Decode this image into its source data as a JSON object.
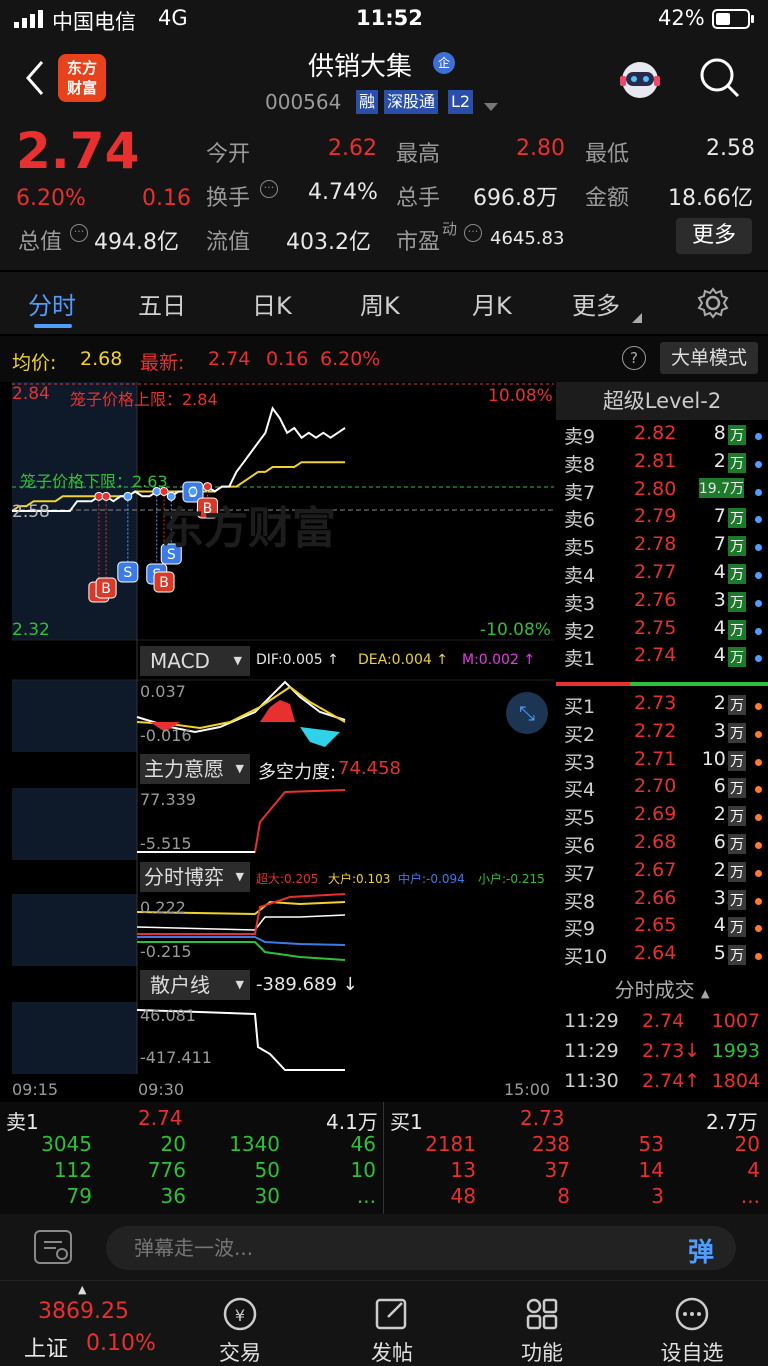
{
  "status": {
    "carrier": "中国电信",
    "network": "4G",
    "time": "11:52",
    "battery": "42%"
  },
  "header": {
    "logo_top": "东方",
    "logo_bottom": "财富",
    "stock_name": "供销大集",
    "badge": "企",
    "code": "000564",
    "tags": [
      "融",
      "深股通",
      "L2"
    ]
  },
  "quote": {
    "price": "2.74",
    "change_pct": "6.20%",
    "change": "0.16",
    "open_label": "今开",
    "open": "2.62",
    "high_label": "最高",
    "high": "2.80",
    "low_label": "最低",
    "low": "2.58",
    "turnover_label": "换手",
    "turnover": "4.74%",
    "volume_label": "总手",
    "volume": "696.8万",
    "amount_label": "金额",
    "amount": "18.66亿",
    "mcap_label": "总值",
    "mcap": "494.8亿",
    "float_label": "流值",
    "float": "403.2亿",
    "pe_label": "市盈",
    "pe_sup": "动",
    "pe": "4645.83",
    "more": "更多"
  },
  "tabs": [
    "分时",
    "五日",
    "日K",
    "周K",
    "月K",
    "更多"
  ],
  "avg": {
    "avg_label": "均价:",
    "avg": "2.68",
    "latest_label": "最新:",
    "latest": "2.74",
    "chg": "0.16",
    "pct": "6.20%",
    "help": "?",
    "mode": "大单模式"
  },
  "chart": {
    "price_top": "2.84",
    "price_mid": "2.58",
    "price_bottom": "2.32",
    "pct_top": "10.08%",
    "pct_bottom": "-10.08%",
    "upper_limit": "笼子价格上限：2.84",
    "lower_limit": "笼子价格下限：2.63",
    "watermark": "东方财富",
    "macd_label": "MACD",
    "dif": "DIF:0.005 ↑",
    "dea": "DEA:0.004 ↑",
    "m": "M:0.002 ↑",
    "macd_hi": "0.037",
    "macd_lo": "-0.016",
    "zl_label": "主力意愿",
    "zl_name": "多空力度:",
    "zl_val": "74.458",
    "zl_hi": "77.339",
    "zl_lo": "-5.515",
    "by_label": "分时博弈",
    "by_big": "超大:0.205",
    "by_large": "大户:0.103",
    "by_mid": "中户:-0.094",
    "by_small": "小户:-0.215",
    "by_hi": "0.222",
    "by_lo": "-0.215",
    "sh_label": "散户线",
    "sh_val": "-389.689 ↓",
    "sh_hi": "46.081",
    "sh_lo": "-417.411",
    "t0": "09:15",
    "t1": "09:30",
    "t2": "15:00",
    "price_series": [
      2.58,
      2.58,
      2.58,
      2.58,
      2.58,
      2.58,
      2.58,
      2.58,
      2.58,
      2.6,
      2.6,
      2.6,
      2.61,
      2.61,
      2.6,
      2.61,
      2.61,
      2.62,
      2.61,
      2.61,
      2.62,
      2.62,
      2.61,
      2.62,
      2.62,
      2.62,
      2.63,
      2.63,
      2.62,
      2.63,
      2.63,
      2.66,
      2.68,
      2.7,
      2.72,
      2.74,
      2.79,
      2.77,
      2.74,
      2.75,
      2.73,
      2.74,
      2.73,
      2.74,
      2.73,
      2.74,
      2.75
    ],
    "avg_series": [
      2.58,
      2.59,
      2.59,
      2.6,
      2.6,
      2.6,
      2.6,
      2.61,
      2.61,
      2.61,
      2.61,
      2.61,
      2.61,
      2.61,
      2.61,
      2.61,
      2.61,
      2.62,
      2.62,
      2.62,
      2.62,
      2.62,
      2.62,
      2.62,
      2.62,
      2.62,
      2.62,
      2.62,
      2.62,
      2.63,
      2.63,
      2.63,
      2.64,
      2.65,
      2.66,
      2.66,
      2.67,
      2.67,
      2.67,
      2.67,
      2.68,
      2.68,
      2.68,
      2.68,
      2.68,
      2.68,
      2.68
    ]
  },
  "orderbook": {
    "title": "超级Level-2",
    "asks": [
      {
        "label": "卖9",
        "price": "2.82",
        "vol": "8.8",
        "tag": "万"
      },
      {
        "label": "卖8",
        "price": "2.81",
        "vol": "2.9",
        "tag": "万"
      },
      {
        "label": "卖7",
        "price": "2.80",
        "vol": "19.7万",
        "tag": ""
      },
      {
        "label": "卖6",
        "price": "2.79",
        "vol": "7.3",
        "tag": "万"
      },
      {
        "label": "卖5",
        "price": "2.78",
        "vol": "7.3",
        "tag": "万"
      },
      {
        "label": "卖4",
        "price": "2.77",
        "vol": "4.0",
        "tag": "万"
      },
      {
        "label": "卖3",
        "price": "2.76",
        "vol": "3.1",
        "tag": "万"
      },
      {
        "label": "卖2",
        "price": "2.75",
        "vol": "4.7",
        "tag": "万"
      },
      {
        "label": "卖1",
        "price": "2.74",
        "vol": "4.1",
        "tag": "万"
      }
    ],
    "bids": [
      {
        "label": "买1",
        "price": "2.73",
        "vol": "2.7",
        "tag": "万"
      },
      {
        "label": "买2",
        "price": "2.72",
        "vol": "3.8",
        "tag": "万"
      },
      {
        "label": "买3",
        "price": "2.71",
        "vol": "10.1",
        "tag": "万"
      },
      {
        "label": "买4",
        "price": "2.70",
        "vol": "6.5",
        "tag": "万"
      },
      {
        "label": "买5",
        "price": "2.69",
        "vol": "2.9",
        "tag": "万"
      },
      {
        "label": "买6",
        "price": "2.68",
        "vol": "6.5",
        "tag": "万"
      },
      {
        "label": "买7",
        "price": "2.67",
        "vol": "2.0",
        "tag": "万"
      },
      {
        "label": "买8",
        "price": "2.66",
        "vol": "3.5",
        "tag": "万"
      },
      {
        "label": "买9",
        "price": "2.65",
        "vol": "4.8",
        "tag": "万"
      },
      {
        "label": "买10",
        "price": "2.64",
        "vol": "5.1",
        "tag": "万"
      }
    ],
    "trades_title": "分时成交",
    "trades": [
      {
        "time": "11:29",
        "price": "2.74",
        "vol": "1007"
      },
      {
        "time": "11:29",
        "price": "2.73↓",
        "vol": "1993"
      },
      {
        "time": "11:30",
        "price": "2.74↑",
        "vol": "1804"
      }
    ]
  },
  "queue": {
    "sell_label": "卖1",
    "sell_price": "2.74",
    "sell_vol": "4.1万",
    "buy_label": "买1",
    "buy_price": "2.73",
    "buy_vol": "2.7万",
    "sell_rows": [
      [
        "3045",
        "20",
        "1340",
        "46"
      ],
      [
        "112",
        "776",
        "50",
        "10"
      ],
      [
        "79",
        "36",
        "30",
        "..."
      ]
    ],
    "buy_rows": [
      [
        "2181",
        "238",
        "53",
        "20"
      ],
      [
        "13",
        "37",
        "14",
        "4"
      ],
      [
        "48",
        "8",
        "3",
        "..."
      ]
    ]
  },
  "comment": {
    "placeholder": "弹幕走一波...",
    "button": "弹"
  },
  "bottom": {
    "index_value": "3869.25",
    "index_name": "上证",
    "index_pct": "0.10%",
    "items": [
      "交易",
      "发帖",
      "功能",
      "设自选"
    ]
  }
}
